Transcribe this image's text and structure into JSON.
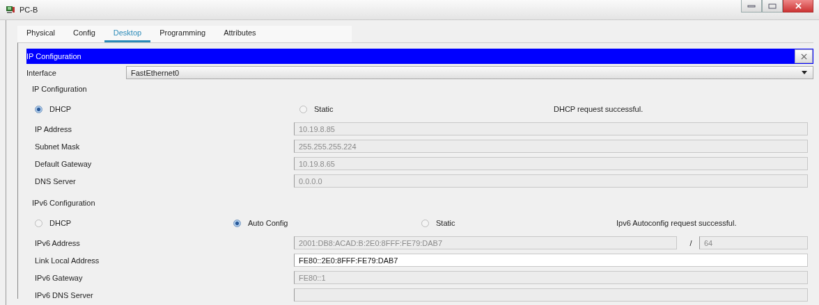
{
  "window": {
    "title": "PC-B"
  },
  "tabs": [
    {
      "label": "Physical",
      "selected": false
    },
    {
      "label": "Config",
      "selected": false
    },
    {
      "label": "Desktop",
      "selected": true
    },
    {
      "label": "Programming",
      "selected": false
    },
    {
      "label": "Attributes",
      "selected": false
    }
  ],
  "panel": {
    "title": "IP Configuration"
  },
  "interface": {
    "label": "Interface",
    "value": "FastEthernet0"
  },
  "sections": [
    {
      "title": "IP Configuration",
      "status": "DHCP request successful.",
      "modes": [
        {
          "label": "DHCP",
          "selected": true
        },
        {
          "label": "Static",
          "selected": false
        }
      ],
      "fields": [
        {
          "label": "IP Address",
          "value": "10.19.8.85",
          "disabled": true
        },
        {
          "label": "Subnet Mask",
          "value": "255.255.255.224",
          "disabled": true
        },
        {
          "label": "Default Gateway",
          "value": "10.19.8.65",
          "disabled": true
        },
        {
          "label": "DNS Server",
          "value": "0.0.0.0",
          "disabled": true
        }
      ]
    },
    {
      "title": "IPv6 Configuration",
      "status": "Ipv6 Autoconfig request successful.",
      "modes": [
        {
          "label": "DHCP",
          "selected": false
        },
        {
          "label": "Auto Config",
          "selected": true
        },
        {
          "label": "Static",
          "selected": false
        }
      ],
      "fields": [
        {
          "label": "IPv6 Address",
          "value": "2001:DB8:ACAD:B:2E0:8FFF:FE79:DAB7",
          "disabled": true,
          "separator": "/",
          "prefix": "64"
        },
        {
          "label": "Link Local Address",
          "value": "FE80::2E0:8FFF:FE79:DAB7",
          "disabled": false
        },
        {
          "label": "IPv6 Gateway",
          "value": "FE80::1",
          "disabled": true
        },
        {
          "label": "IPv6 DNS Server",
          "disabled": true
        }
      ]
    }
  ]
}
